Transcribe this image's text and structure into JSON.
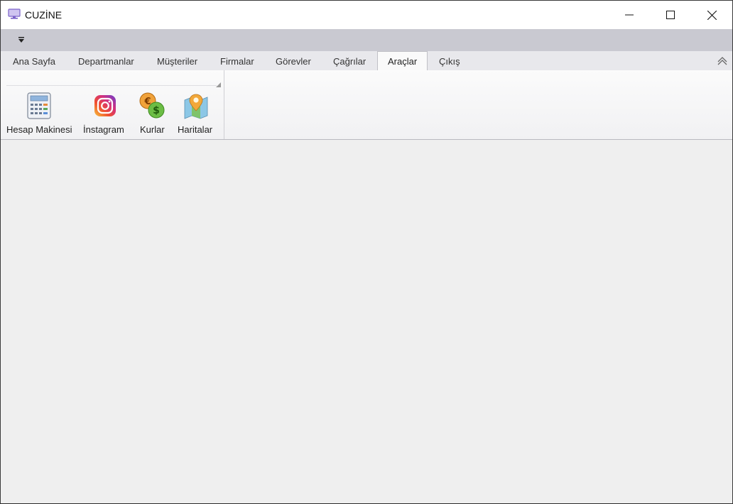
{
  "window": {
    "title": "CUZİNE",
    "icon": "monitor-app-icon",
    "controls": [
      "minimize-icon",
      "maximize-icon",
      "close-icon"
    ]
  },
  "quick_access": {
    "dropdown_icon": "customize-dropdown-icon"
  },
  "tabs": [
    {
      "label": "Ana Sayfa",
      "active": false
    },
    {
      "label": "Departmanlar",
      "active": false
    },
    {
      "label": "Müşteriler",
      "active": false
    },
    {
      "label": "Firmalar",
      "active": false
    },
    {
      "label": "Görevler",
      "active": false
    },
    {
      "label": "Çağrılar",
      "active": false
    },
    {
      "label": "Araçlar",
      "active": true
    },
    {
      "label": "Çıkış",
      "active": false
    }
  ],
  "ribbon": {
    "buttons": [
      {
        "label": "Hesap Makinesi",
        "icon": "calculator-icon"
      },
      {
        "label": "İnstagram",
        "icon": "instagram-icon"
      },
      {
        "label": "Kurlar",
        "icon": "currency-icon"
      },
      {
        "label": "Haritalar",
        "icon": "map-icon"
      }
    ]
  }
}
